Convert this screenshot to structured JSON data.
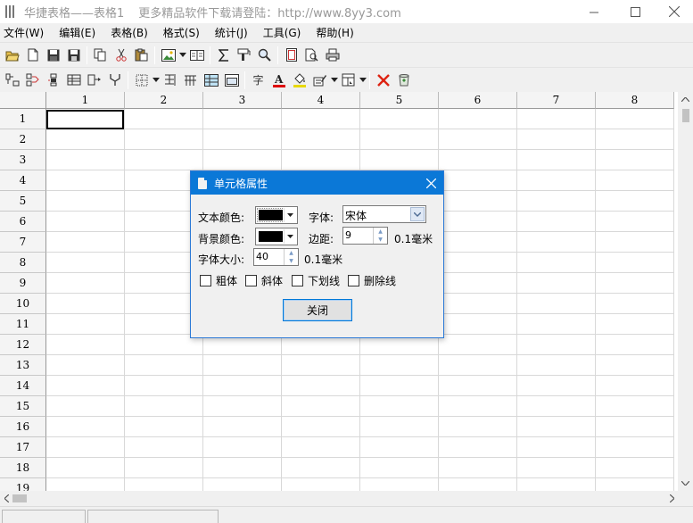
{
  "window": {
    "title": "华捷表格——表格1",
    "subtitle": "更多精品软件下载请登陆：http://www.8yy3.com"
  },
  "menu": [
    {
      "label": "文件(W)",
      "name": "menu-file"
    },
    {
      "label": "编辑(E)",
      "name": "menu-edit"
    },
    {
      "label": "表格(B)",
      "name": "menu-table"
    },
    {
      "label": "格式(S)",
      "name": "menu-format"
    },
    {
      "label": "统计(J)",
      "name": "menu-stats"
    },
    {
      "label": "工具(G)",
      "name": "menu-tools"
    },
    {
      "label": "帮助(H)",
      "name": "menu-help"
    }
  ],
  "toolbar2": {
    "font_char": "字"
  },
  "grid": {
    "columns": [
      "1",
      "2",
      "3",
      "4",
      "5",
      "6",
      "7",
      "8"
    ],
    "rows": [
      "1",
      "2",
      "3",
      "4",
      "5",
      "6",
      "7",
      "8",
      "9",
      "10",
      "11",
      "12",
      "13",
      "14",
      "15",
      "16",
      "17",
      "18",
      "19"
    ]
  },
  "dialog": {
    "title": "单元格属性",
    "text_color_label": "文本颜色:",
    "bg_color_label": "背景颜色:",
    "font_label": "字体:",
    "font_value": "宋体",
    "margin_label": "边距:",
    "margin_value": "9",
    "margin_unit": "0.1毫米",
    "font_size_label": "字体大小:",
    "font_size_value": "40",
    "font_size_unit": "0.1毫米",
    "checkboxes": {
      "bold": "粗体",
      "italic": "斜体",
      "underline": "下划线",
      "strikethrough": "删除线"
    },
    "close_button": "关闭",
    "text_color": "#000000",
    "bg_color": "#000000"
  },
  "colors": {
    "dialog_title_bg": "#0b78d7",
    "grid_line": "#d8d8d8"
  }
}
